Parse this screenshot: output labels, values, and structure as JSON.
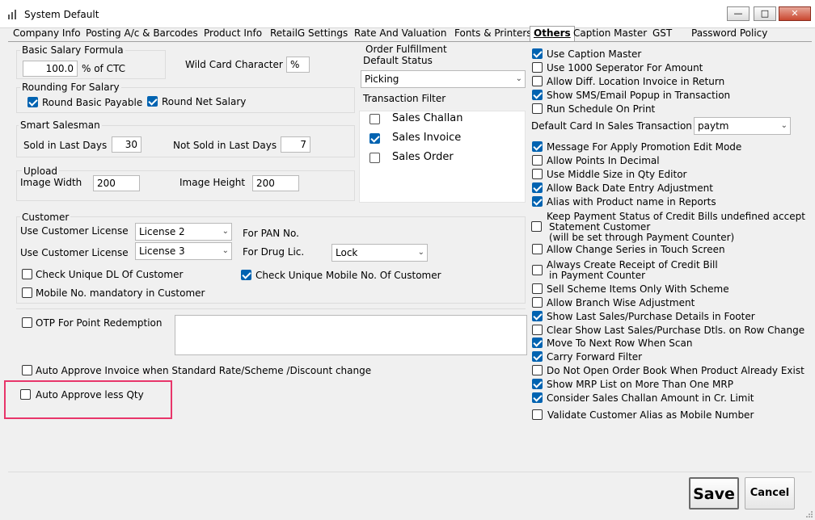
{
  "window": {
    "title": "System Default"
  },
  "tabs": [
    "Company Info",
    "Product Info"
  ],
  "tabs_all": [
    {
      "label": "Company Info",
      "active": false
    },
    {
      "label": "Posting A/c & Barcodes",
      "active": false
    },
    {
      "label": "Product Info",
      "active": false
    },
    {
      "label": "RetailG Settings",
      "active": false
    },
    {
      "label": "Rate And Valuation",
      "active": false
    },
    {
      "label": "Fonts & Printers",
      "active": false
    },
    {
      "label": "Others",
      "active": true
    },
    {
      "label": "Caption Master",
      "active": false
    },
    {
      "label": "GST",
      "active": false
    },
    {
      "label": "Password Policy",
      "active": false
    }
  ],
  "basic_salary": {
    "group_label": "Basic Salary Formula",
    "value": "100.0",
    "unit": "% of CTC"
  },
  "wildcard": {
    "label": "Wild Card Character",
    "value": "%"
  },
  "rounding": {
    "group_label": "Rounding For Salary",
    "round_basic": "Round Basic Payable",
    "round_net": "Round Net Salary"
  },
  "smart_salesman": {
    "group_label": "Smart Salesman",
    "sold_label": "Sold in Last Days",
    "sold_value": "30",
    "not_sold_label": "Not Sold in Last Days",
    "not_sold_value": "7"
  },
  "upload": {
    "group_label": "Upload",
    "width_label": "Image Width",
    "width_value": "200",
    "height_label": "Image Height",
    "height_value": "200"
  },
  "order_fulfillment": {
    "group_label": "Order Fulfillment",
    "status_label": "Default Status",
    "status_value": "Picking",
    "filter_label": "Transaction Filter",
    "filters": [
      {
        "label": "Sales Challan",
        "checked": false
      },
      {
        "label": "Sales Invoice",
        "checked": true
      },
      {
        "label": "Sales Order",
        "checked": false
      }
    ]
  },
  "customer": {
    "group_label": "Customer",
    "license_label_1": "Use Customer License",
    "license_value_1": "License 2",
    "license_label_2": "Use Customer License",
    "license_value_2": "License 3",
    "pan_label": "For PAN No.",
    "drug_label": "For Drug Lic.",
    "drug_value": "Lock",
    "check_dl": "Check Unique DL Of Customer",
    "check_mobile": "Check Unique Mobile No. Of Customer",
    "mobile_mandatory": "Mobile No. mandatory in Customer"
  },
  "otp": {
    "label": "OTP For Point Redemption"
  },
  "auto_approve_invoice": "Auto Approve Invoice when Standard Rate/Scheme /Discount change",
  "auto_approve_qty": "Auto Approve less Qty",
  "right_top": [
    {
      "label": "Use Caption Master",
      "checked": true
    },
    {
      "label": "Use 1000 Seperator For Amount",
      "checked": false
    },
    {
      "label": "Allow Diff. Location Invoice in Return",
      "checked": false
    },
    {
      "label": "Show SMS/Email Popup in Transaction",
      "checked": true
    },
    {
      "label": "Run Schedule On Print",
      "checked": false
    }
  ],
  "default_card": {
    "label": "Default Card In Sales Transaction",
    "value": "paytm"
  },
  "right_mid": [
    {
      "label": "Message For Apply Promotion Edit Mode",
      "checked": true
    },
    {
      "label": "Allow Points In Decimal",
      "checked": false
    },
    {
      "label": "Use Middle Size in Qty Editor",
      "checked": false
    },
    {
      "label": "Allow Back Date Entry Adjustment",
      "checked": true
    },
    {
      "label": "Alias with Product name in Reports",
      "checked": true
    }
  ],
  "keep_payment": {
    "line1": "Keep Payment Status of Credit Bills undefined accept",
    "line2": "Statement Customer",
    "line3": "(will be set through Payment Counter)"
  },
  "allow_change_series": "Allow Change Series in Touch Screen",
  "always_create": {
    "line1": "Always Create Receipt of Credit Bill",
    "line2": "in Payment Counter"
  },
  "right_bottom": [
    {
      "label": "Sell Scheme Items Only With Scheme",
      "checked": false
    },
    {
      "label": "Allow Branch Wise Adjustment",
      "checked": false
    },
    {
      "label": "Show Last Sales/Purchase Details in Footer",
      "checked": true
    },
    {
      "label": "Clear Show Last Sales/Purchase Dtls. on Row Change",
      "checked": false
    },
    {
      "label": "Move To Next Row When Scan",
      "checked": true
    },
    {
      "label": "Carry Forward Filter",
      "checked": true
    },
    {
      "label": "Do Not Open Order Book When Product Already Exist",
      "checked": false
    },
    {
      "label": "Show MRP List on More Than One MRP",
      "checked": true
    },
    {
      "label": "Consider Sales Challan Amount in Cr. Limit",
      "checked": true
    }
  ],
  "validate_alias": "Validate Customer Alias as Mobile Number",
  "buttons": {
    "save": "Save",
    "cancel": "Cancel"
  },
  "colors": {
    "accent": "#0063b1",
    "highlight": "#e8356a"
  }
}
